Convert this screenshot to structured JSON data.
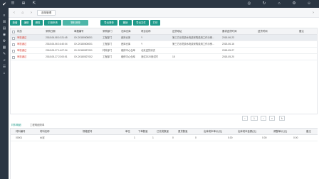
{
  "sidebar": {
    "items": [
      "✔",
      "≡",
      "⊞",
      "▤",
      "◉",
      "⚙",
      "▦",
      "✎",
      "♫",
      "☰",
      "⌂"
    ]
  },
  "topbar": {
    "icons": [
      "☰",
      "⊞",
      "⇱",
      "◎",
      "↻",
      "⌂",
      "⚙",
      "☺"
    ]
  },
  "tabs": {
    "active_label": "选单管理"
  },
  "toolbar": {
    "buttons": [
      "新增",
      "编辑",
      "删除",
      "引用申请",
      "物料清单",
      "导出清单",
      "撤销",
      "导出文件",
      "打印"
    ]
  },
  "grid1": {
    "headers": [
      "状态",
      "采购日期",
      "单据编号",
      "采购部门",
      "仓库仓库",
      "项目名称",
      "送货地址",
      "要求送货时间",
      "送货时间",
      "备注"
    ],
    "rows": [
      [
        "审核通过",
        "2018-06-08 10:21:45",
        "CK-20180608001",
        "工程部门",
        "西库仓库",
        "Y",
        "第三方示范费水电费采购费用工作示例...",
        "2018-06-23",
        "",
        ""
      ],
      [
        "审核通过",
        "2018-06-06 16:40:04",
        "CK-20180606001",
        "工程部门",
        "西库仓库",
        "Y",
        "第三方示范费水电费采购费用工作示例...",
        "2018-06-16",
        "",
        ""
      ],
      [
        "审核通过",
        "2018-05-27 14:07:34",
        "CK-20180527001",
        "材料部门",
        "维修中心仓库",
        "北京送货测试",
        "",
        "2018-05-27",
        "",
        ""
      ],
      [
        "审核通过",
        "2018-05-27 22:00:51",
        "CK-20180527002",
        "工程部门",
        "维修中心仓库",
        "测试2020测试时",
        "15",
        "2018-05-20",
        "",
        ""
      ]
    ]
  },
  "pager": {
    "prev": "‹",
    "page": "1",
    "next": "›",
    "refresh": "↻",
    "last": "»"
  },
  "subtabs": [
    "材料明细",
    "工程明细清单"
  ],
  "grid2": {
    "headers": [
      "材料编号",
      "材料名称",
      "规格型号",
      "单位",
      "下单数量",
      "已完成数量",
      "退货数量",
      "出库成本单价(元)",
      "出库成本金额(元)",
      "调整单价(元)",
      "备注"
    ],
    "rows": [
      [
        "00001",
        "水泥",
        "",
        "1",
        "1",
        "0",
        "0",
        "0.00",
        "0.00",
        "0.00",
        ""
      ]
    ]
  }
}
